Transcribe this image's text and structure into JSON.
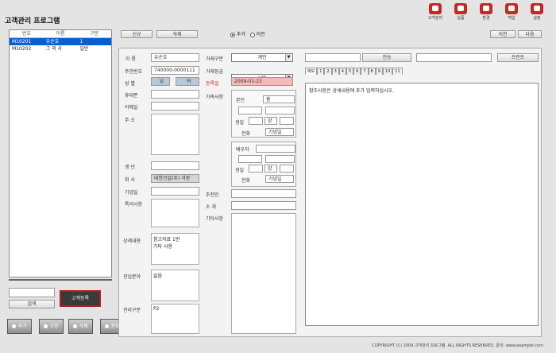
{
  "app": {
    "title": "고객관리 프로그램"
  },
  "toolbar": {
    "items": [
      {
        "label": "고객관리",
        "icon": "person-icon"
      },
      {
        "label": "상품",
        "icon": "product-icon"
      },
      {
        "label": "환경",
        "icon": "tools-icon"
      },
      {
        "label": "백업",
        "icon": "backup-icon"
      },
      {
        "label": "설정",
        "icon": "gear-icon"
      }
    ]
  },
  "customer_list": {
    "columns": [
      "번호",
      "이름",
      "구분"
    ],
    "rows": [
      {
        "no": "M10201",
        "name": "유순호",
        "type": "1"
      },
      {
        "no": "M10202",
        "name": "그 외 사",
        "type": "일반"
      }
    ]
  },
  "top_buttons": {
    "new": "신규",
    "delete": "삭제",
    "prev": "이전",
    "next": "다음"
  },
  "radio": {
    "opt1": "추가",
    "opt2": "이전"
  },
  "form": {
    "name_label": "이 름",
    "name_value": "유순호",
    "id_label": "주민번호",
    "id_value": "740000-0000111",
    "gender_label": "성 별",
    "gender_m": "남",
    "gender_f": "여",
    "phone_label": "휴대폰",
    "phone2_label": "이메일",
    "email_label": "이메일",
    "addr_label": "주 소",
    "birth_label": "생 년",
    "birth_value": "",
    "company_label": "회 사",
    "company_value": "대한건설(주) 과장",
    "etc_label": "기념일",
    "note_label": "특이사항",
    "detail_label": "상세내용",
    "detail_value": "참고자료 1번\n기타 사항",
    "memo1_label": "관심분야",
    "memo1_value": "없음",
    "memo2_label": "관리구분",
    "memo2_value": "P2"
  },
  "mid": {
    "cat_label": "거래구분",
    "cat_value": "개인",
    "grade_label": "거래등급",
    "grade_value": "VIP",
    "date_label": "등록일",
    "date_value": "2009-01-23",
    "group_label": "가족사항",
    "box1": {
      "l1": "본인",
      "v1": "홍",
      "l2": "생일",
      "v2": "",
      "v3": "양",
      "l4": "전화",
      "v4": "기념일"
    },
    "box2": {
      "l1": "배우자",
      "v1": "",
      "l2": "생일",
      "v2": "",
      "v3": "양",
      "l4": "전화",
      "v4": "기념일"
    },
    "ref_label": "추천인",
    "ref_value": "",
    "src_label": "소 개",
    "src_value": "",
    "misc_label": "기타사항",
    "misc_value": ""
  },
  "right": {
    "send_btn": "전송",
    "print_btn": "프린트",
    "tabs": [
      "메모",
      "1",
      "2",
      "3",
      "4",
      "5",
      "6",
      "7",
      "8",
      "9",
      "10",
      "11"
    ],
    "memo_text": "참조사항은 상세내용에 추가 입력하십시오."
  },
  "bottom_left": {
    "search_placeholder": "",
    "search_btn": "검색",
    "register_btn": "고객등록",
    "btns": [
      "추가",
      "수정",
      "삭제",
      "종료"
    ]
  },
  "footer": {
    "text": "COPYRIGHT (C) 2009 고객관리 프로그램. ALL RIGHTS RESERVED. 문의: www.example.com"
  }
}
